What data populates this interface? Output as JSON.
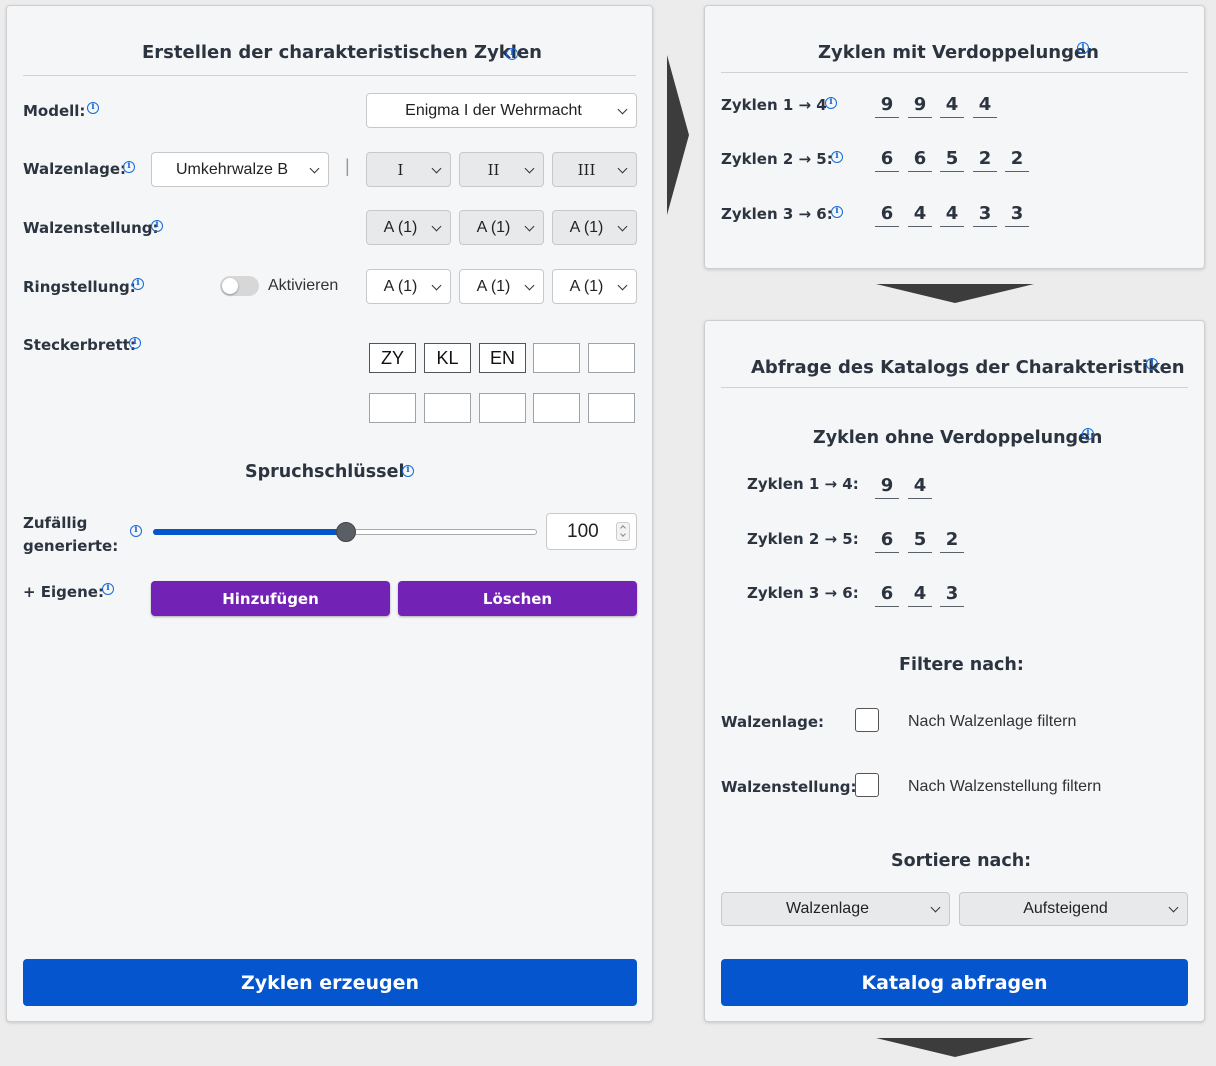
{
  "left": {
    "title": "Erstellen der charakteristischen Zyklen",
    "modell_label": "Modell:",
    "modell_value": "Enigma I der Wehrmacht",
    "walzenlage_label": "Walzenlage:",
    "umkehrwalze_value": "Umkehrwalze B",
    "separator": "|",
    "walzen": [
      "I",
      "II",
      "III"
    ],
    "walzenstellung_label": "Walzenstellung:",
    "walzenstellung": [
      "A (1)",
      "A (1)",
      "A (1)"
    ],
    "ringstellung_label": "Ringstellung:",
    "ring_toggle_label": "Aktivieren",
    "ringstellung": [
      "A (1)",
      "A (1)",
      "A (1)"
    ],
    "steckerbrett_label": "Steckerbrett:",
    "plugs": [
      "ZY",
      "KL",
      "EN",
      "",
      "",
      "",
      "",
      "",
      "",
      ""
    ],
    "spruchschluessel_title": "Spruchschlüssel",
    "zufaellig_label_1": "Zufällig",
    "zufaellig_label_2": "generierte:",
    "slider_value": 100,
    "number_value": "100",
    "eigene_label": "+ Eigene:",
    "add_button": "Hinzufügen",
    "delete_button": "Löschen",
    "generate_button": "Zyklen erzeugen"
  },
  "right_top": {
    "title": "Zyklen mit Verdoppelungen",
    "rows": [
      {
        "label": "Zyklen 1 → 4",
        "digits": [
          "9",
          "9",
          "4",
          "4"
        ]
      },
      {
        "label": "Zyklen 2 → 5:",
        "digits": [
          "6",
          "6",
          "5",
          "2",
          "2"
        ]
      },
      {
        "label": "Zyklen 3 → 6:",
        "digits": [
          "6",
          "4",
          "4",
          "3",
          "3"
        ]
      }
    ]
  },
  "right_bottom": {
    "title": "Abfrage des Katalogs der Charakteristiken",
    "subtitle": "Zyklen ohne Verdoppelungen",
    "rows": [
      {
        "label": "Zyklen 1 → 4:",
        "digits": [
          "9",
          "4"
        ]
      },
      {
        "label": "Zyklen 2 → 5:",
        "digits": [
          "6",
          "5",
          "2"
        ]
      },
      {
        "label": "Zyklen 3 → 6:",
        "digits": [
          "6",
          "4",
          "3"
        ]
      }
    ],
    "filter_title": "Filtere nach:",
    "filter_walzenlage_label": "Walzenlage:",
    "filter_walzenlage_text": "Nach Walzenlage filtern",
    "filter_walzenstellung_label": "Walzenstellung:",
    "filter_walzenstellung_text": "Nach Walzenstellung filtern",
    "sort_title": "Sortiere nach:",
    "sort_field": "Walzenlage",
    "sort_order": "Aufsteigend",
    "query_button": "Katalog abfragen"
  },
  "icons": {
    "info": "info-icon",
    "chevron": "chevron-down-icon"
  },
  "colors": {
    "accent_blue": "#0555cf",
    "purple": "#7222b4",
    "slider_blue": "#0555cf",
    "info_blue": "#1769d8"
  }
}
